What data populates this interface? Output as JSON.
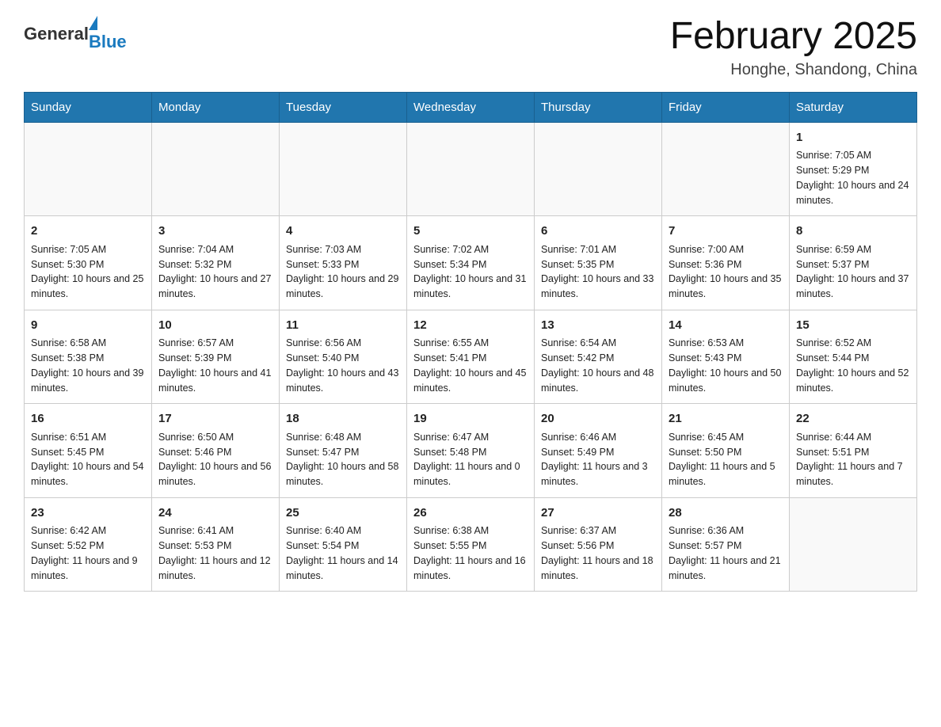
{
  "header": {
    "logo_general": "General",
    "logo_blue": "Blue",
    "month_title": "February 2025",
    "location": "Honghe, Shandong, China"
  },
  "days_of_week": [
    "Sunday",
    "Monday",
    "Tuesday",
    "Wednesday",
    "Thursday",
    "Friday",
    "Saturday"
  ],
  "weeks": [
    [
      {
        "day": "",
        "info": ""
      },
      {
        "day": "",
        "info": ""
      },
      {
        "day": "",
        "info": ""
      },
      {
        "day": "",
        "info": ""
      },
      {
        "day": "",
        "info": ""
      },
      {
        "day": "",
        "info": ""
      },
      {
        "day": "1",
        "info": "Sunrise: 7:05 AM\nSunset: 5:29 PM\nDaylight: 10 hours and 24 minutes."
      }
    ],
    [
      {
        "day": "2",
        "info": "Sunrise: 7:05 AM\nSunset: 5:30 PM\nDaylight: 10 hours and 25 minutes."
      },
      {
        "day": "3",
        "info": "Sunrise: 7:04 AM\nSunset: 5:32 PM\nDaylight: 10 hours and 27 minutes."
      },
      {
        "day": "4",
        "info": "Sunrise: 7:03 AM\nSunset: 5:33 PM\nDaylight: 10 hours and 29 minutes."
      },
      {
        "day": "5",
        "info": "Sunrise: 7:02 AM\nSunset: 5:34 PM\nDaylight: 10 hours and 31 minutes."
      },
      {
        "day": "6",
        "info": "Sunrise: 7:01 AM\nSunset: 5:35 PM\nDaylight: 10 hours and 33 minutes."
      },
      {
        "day": "7",
        "info": "Sunrise: 7:00 AM\nSunset: 5:36 PM\nDaylight: 10 hours and 35 minutes."
      },
      {
        "day": "8",
        "info": "Sunrise: 6:59 AM\nSunset: 5:37 PM\nDaylight: 10 hours and 37 minutes."
      }
    ],
    [
      {
        "day": "9",
        "info": "Sunrise: 6:58 AM\nSunset: 5:38 PM\nDaylight: 10 hours and 39 minutes."
      },
      {
        "day": "10",
        "info": "Sunrise: 6:57 AM\nSunset: 5:39 PM\nDaylight: 10 hours and 41 minutes."
      },
      {
        "day": "11",
        "info": "Sunrise: 6:56 AM\nSunset: 5:40 PM\nDaylight: 10 hours and 43 minutes."
      },
      {
        "day": "12",
        "info": "Sunrise: 6:55 AM\nSunset: 5:41 PM\nDaylight: 10 hours and 45 minutes."
      },
      {
        "day": "13",
        "info": "Sunrise: 6:54 AM\nSunset: 5:42 PM\nDaylight: 10 hours and 48 minutes."
      },
      {
        "day": "14",
        "info": "Sunrise: 6:53 AM\nSunset: 5:43 PM\nDaylight: 10 hours and 50 minutes."
      },
      {
        "day": "15",
        "info": "Sunrise: 6:52 AM\nSunset: 5:44 PM\nDaylight: 10 hours and 52 minutes."
      }
    ],
    [
      {
        "day": "16",
        "info": "Sunrise: 6:51 AM\nSunset: 5:45 PM\nDaylight: 10 hours and 54 minutes."
      },
      {
        "day": "17",
        "info": "Sunrise: 6:50 AM\nSunset: 5:46 PM\nDaylight: 10 hours and 56 minutes."
      },
      {
        "day": "18",
        "info": "Sunrise: 6:48 AM\nSunset: 5:47 PM\nDaylight: 10 hours and 58 minutes."
      },
      {
        "day": "19",
        "info": "Sunrise: 6:47 AM\nSunset: 5:48 PM\nDaylight: 11 hours and 0 minutes."
      },
      {
        "day": "20",
        "info": "Sunrise: 6:46 AM\nSunset: 5:49 PM\nDaylight: 11 hours and 3 minutes."
      },
      {
        "day": "21",
        "info": "Sunrise: 6:45 AM\nSunset: 5:50 PM\nDaylight: 11 hours and 5 minutes."
      },
      {
        "day": "22",
        "info": "Sunrise: 6:44 AM\nSunset: 5:51 PM\nDaylight: 11 hours and 7 minutes."
      }
    ],
    [
      {
        "day": "23",
        "info": "Sunrise: 6:42 AM\nSunset: 5:52 PM\nDaylight: 11 hours and 9 minutes."
      },
      {
        "day": "24",
        "info": "Sunrise: 6:41 AM\nSunset: 5:53 PM\nDaylight: 11 hours and 12 minutes."
      },
      {
        "day": "25",
        "info": "Sunrise: 6:40 AM\nSunset: 5:54 PM\nDaylight: 11 hours and 14 minutes."
      },
      {
        "day": "26",
        "info": "Sunrise: 6:38 AM\nSunset: 5:55 PM\nDaylight: 11 hours and 16 minutes."
      },
      {
        "day": "27",
        "info": "Sunrise: 6:37 AM\nSunset: 5:56 PM\nDaylight: 11 hours and 18 minutes."
      },
      {
        "day": "28",
        "info": "Sunrise: 6:36 AM\nSunset: 5:57 PM\nDaylight: 11 hours and 21 minutes."
      },
      {
        "day": "",
        "info": ""
      }
    ]
  ]
}
